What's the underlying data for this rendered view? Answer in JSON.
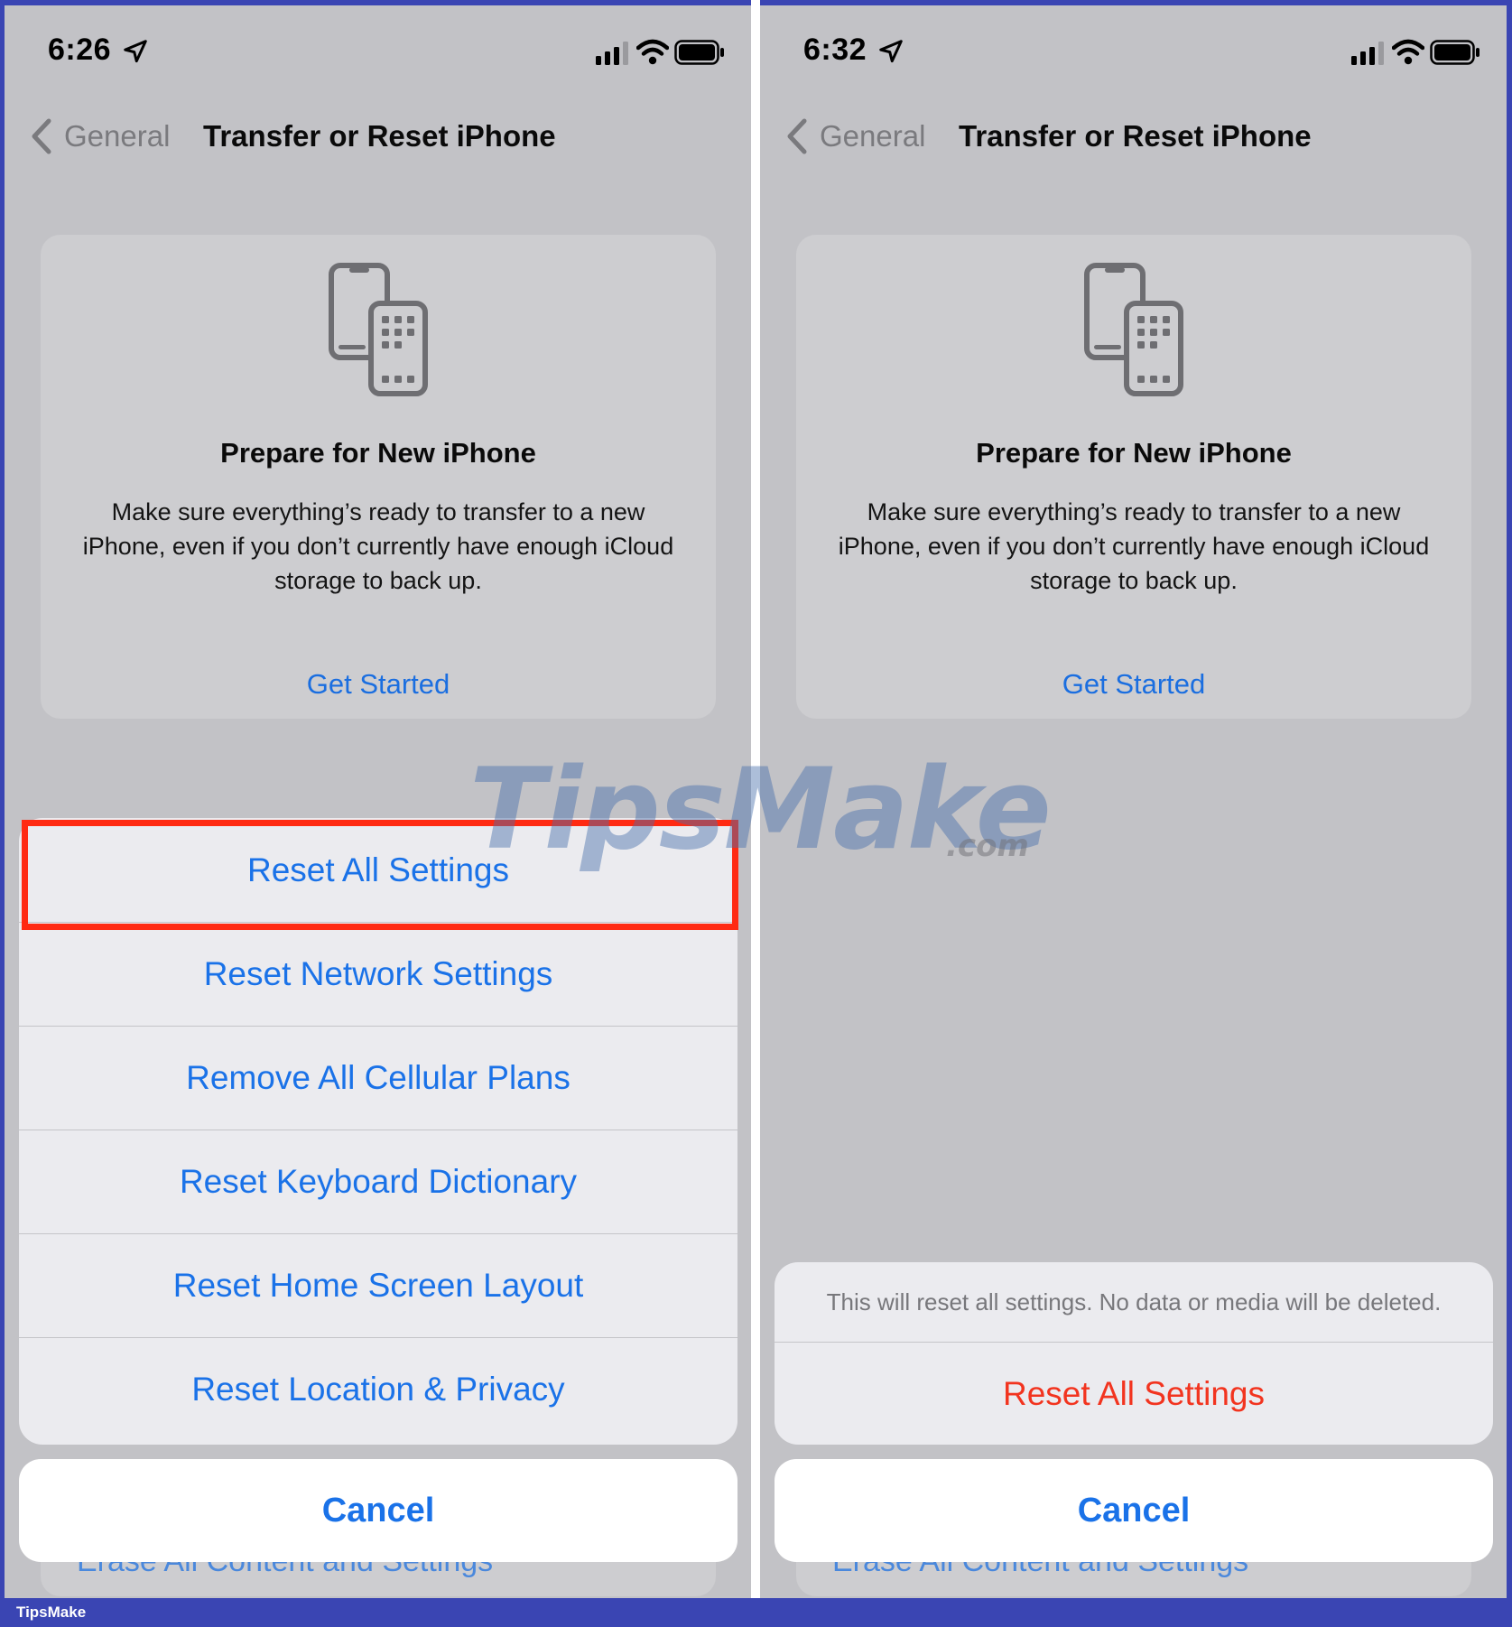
{
  "left": {
    "status": {
      "time": "6:26"
    },
    "nav": {
      "back_label": "General",
      "title": "Transfer or Reset iPhone"
    },
    "card": {
      "title": "Prepare for New iPhone",
      "description": "Make sure everything’s ready to transfer to a new iPhone, even if you don’t currently have enough iCloud storage to back up.",
      "link": "Get Started"
    },
    "sheet": {
      "options": [
        "Reset All Settings",
        "Reset Network Settings",
        "Remove All Cellular Plans",
        "Reset Keyboard Dictionary",
        "Reset Home Screen Layout",
        "Reset Location & Privacy"
      ],
      "cancel": "Cancel"
    },
    "behind_text": "Erase All Content and Settings"
  },
  "right": {
    "status": {
      "time": "6:32"
    },
    "nav": {
      "back_label": "General",
      "title": "Transfer or Reset iPhone"
    },
    "card": {
      "title": "Prepare for New iPhone",
      "description": "Make sure everything’s ready to transfer to a new iPhone, even if you don’t currently have enough iCloud storage to back up.",
      "link": "Get Started"
    },
    "alert": {
      "message": "This will reset all settings. No data or media will be deleted.",
      "confirm": "Reset All Settings",
      "cancel": "Cancel"
    },
    "behind_text": "Erase All Content and Settings"
  },
  "watermark": {
    "main": "TipsMake",
    "suffix": ".com"
  },
  "footer": {
    "brand": "TipsMake"
  },
  "colors": {
    "accent_blue": "#1a72e8",
    "destructive_red": "#f2341f",
    "highlight_red": "#ff2a12",
    "frame_blue": "#3a45b3"
  }
}
